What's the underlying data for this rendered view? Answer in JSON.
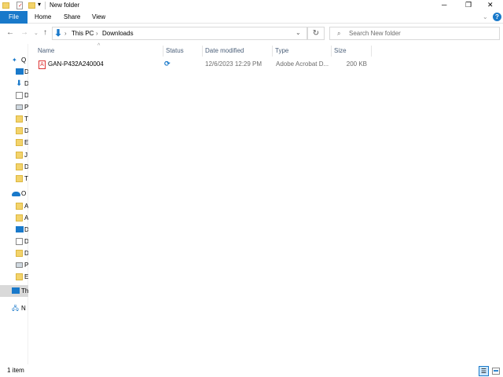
{
  "window": {
    "title": "New folder",
    "minimize": "─",
    "maximize": "❐",
    "close": "✕"
  },
  "ribbon": {
    "tabs": [
      "File",
      "Home",
      "Share",
      "View"
    ],
    "help": "?"
  },
  "address": {
    "path": [
      "This PC",
      "Downloads"
    ],
    "refresh": "↻"
  },
  "search": {
    "placeholder": "Search New folder"
  },
  "sidebar": {
    "items": [
      {
        "label": "Quick access",
        "shown": "Q",
        "icon": "pin-icon"
      },
      {
        "label": "D",
        "shown": "D",
        "icon": "desktop-icon"
      },
      {
        "label": "D",
        "shown": "D",
        "icon": "downloads-icon"
      },
      {
        "label": "D",
        "shown": "D",
        "icon": "documents-icon"
      },
      {
        "label": "P",
        "shown": "P",
        "icon": "pictures-icon"
      },
      {
        "label": "T",
        "shown": "T",
        "icon": "folder-icon"
      },
      {
        "label": "D",
        "shown": "D",
        "icon": "folder-icon"
      },
      {
        "label": "E",
        "shown": "E",
        "icon": "folder-icon"
      },
      {
        "label": "J",
        "shown": "J",
        "icon": "folder-icon"
      },
      {
        "label": "D",
        "shown": "D",
        "icon": "folder-icon"
      },
      {
        "label": "T",
        "shown": "T",
        "icon": "folder-icon"
      },
      {
        "label": "OneDrive",
        "shown": "O",
        "icon": "onedrive-icon"
      },
      {
        "label": "A",
        "shown": "A",
        "icon": "folder-icon"
      },
      {
        "label": "A",
        "shown": "A",
        "icon": "folder-icon"
      },
      {
        "label": "D",
        "shown": "D",
        "icon": "desktop-icon"
      },
      {
        "label": "D",
        "shown": "D",
        "icon": "documents-icon"
      },
      {
        "label": "D",
        "shown": "D",
        "icon": "folder-icon"
      },
      {
        "label": "P",
        "shown": "P",
        "icon": "pictures-icon"
      },
      {
        "label": "E",
        "shown": "E",
        "icon": "folder-icon"
      },
      {
        "label": "This PC",
        "shown": "Th",
        "icon": "this-pc-icon"
      },
      {
        "label": "Network",
        "shown": "N",
        "icon": "network-icon"
      }
    ]
  },
  "columns": [
    "Name",
    "Status",
    "Date modified",
    "Type",
    "Size"
  ],
  "files": [
    {
      "name": "GAN-P432A240004",
      "status": "sync-pending",
      "date": "12/6/2023 12:29 PM",
      "type": "Adobe Acrobat D...",
      "size": "200 KB"
    }
  ],
  "statusbar": {
    "count": "1 item"
  },
  "colors": {
    "accent": "#1979ca",
    "selected": "#cce8ff",
    "folder": "#f3d36b"
  }
}
